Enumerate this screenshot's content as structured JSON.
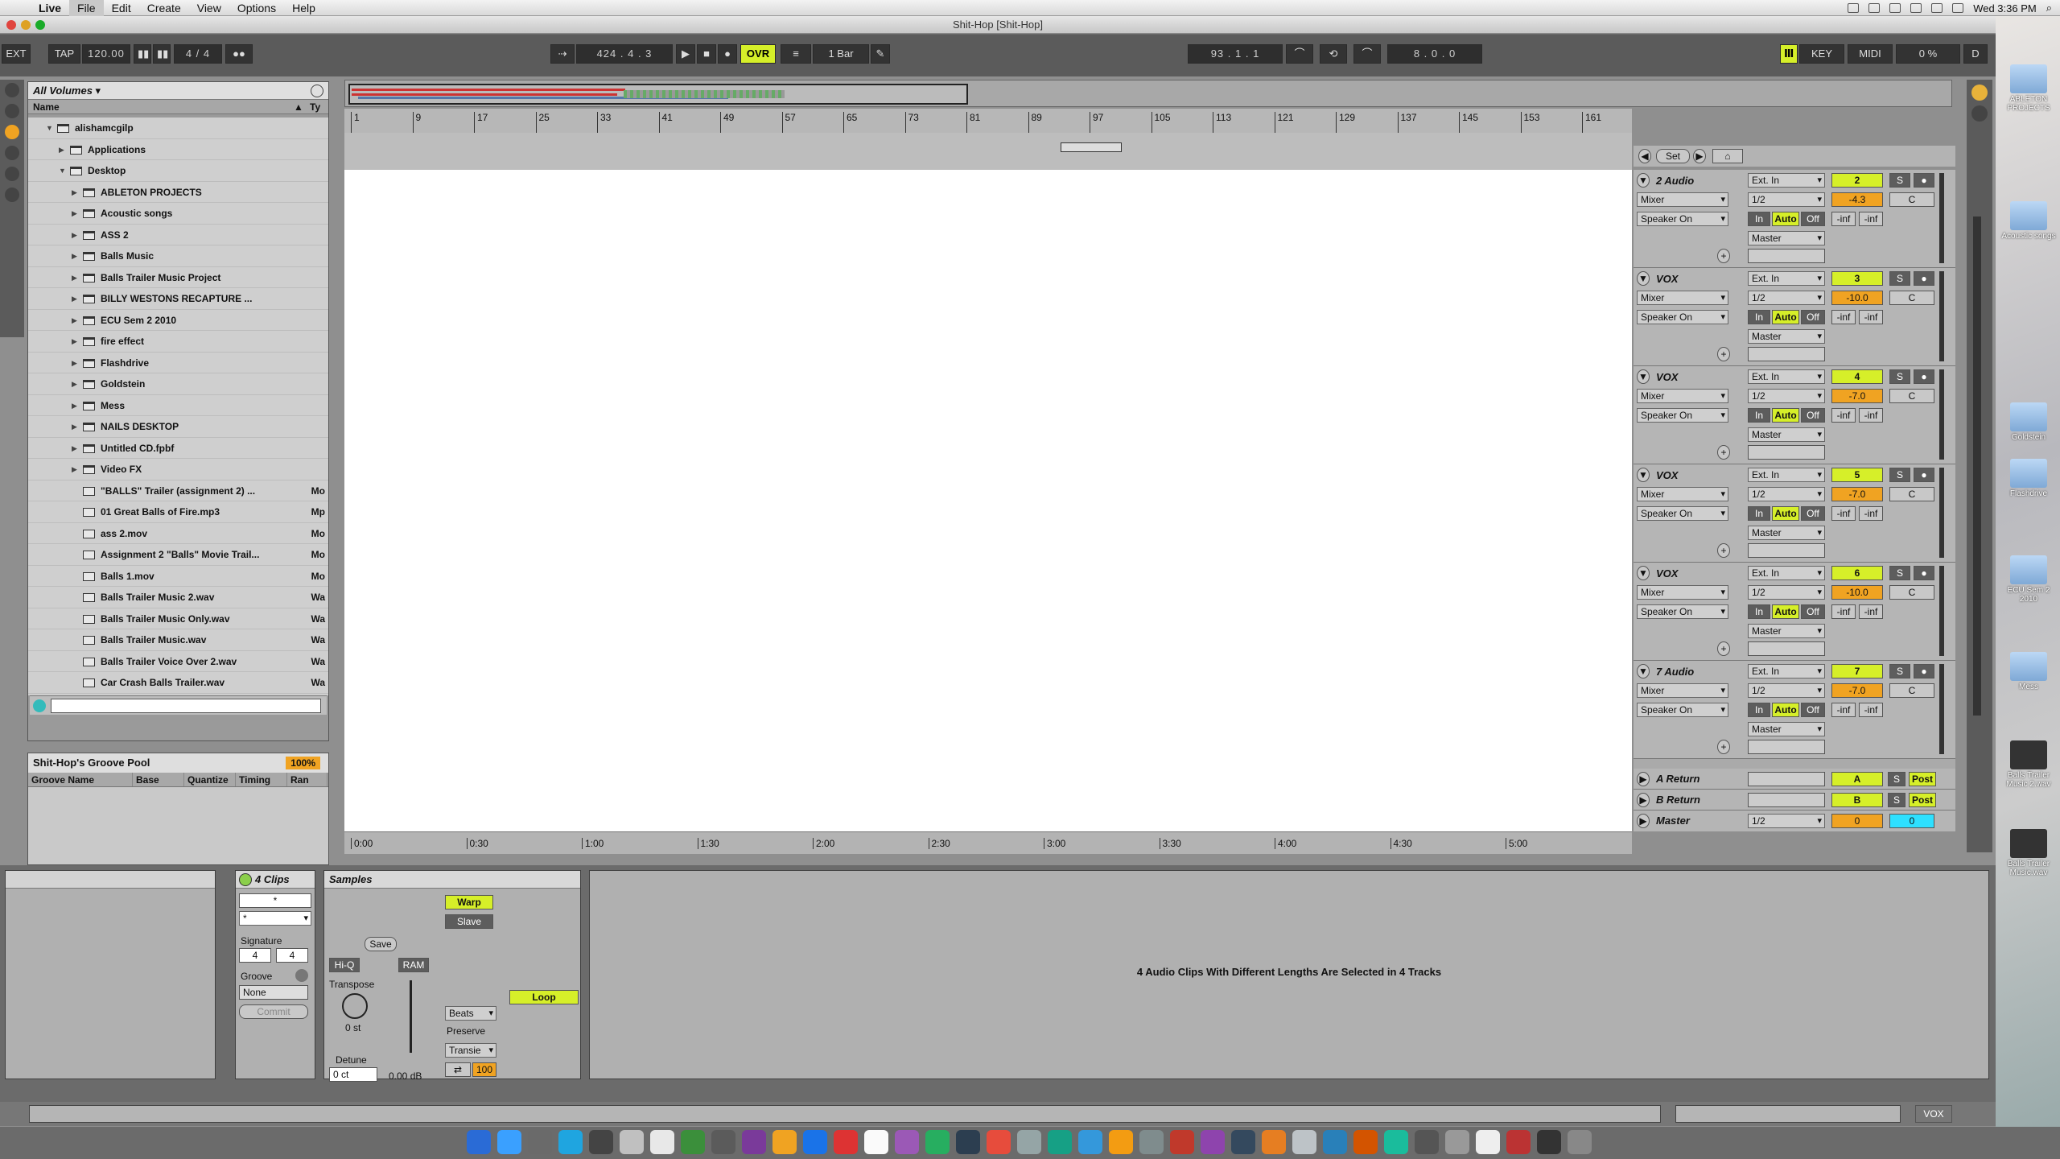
{
  "menubar": {
    "app": "Live",
    "items": [
      "File",
      "Edit",
      "Create",
      "View",
      "Options",
      "Help"
    ],
    "clock": "Wed 3:36 PM"
  },
  "window_title": "Shit-Hop  [Shit-Hop]",
  "control_bar": {
    "ext": "EXT",
    "tap": "TAP",
    "tempo": "120.00",
    "signature": "4 / 4",
    "position": "424 .  4 .  3",
    "ovr": "OVR",
    "quantize": "1 Bar",
    "loop_start": "93 .  1 .  1",
    "loop_length": "8 .  0 .  0",
    "key": "KEY",
    "midi": "MIDI",
    "cpu": "0 %",
    "d": "D"
  },
  "browser": {
    "location": "All Volumes",
    "col_name": "Name",
    "col_type": "Ty",
    "rows": [
      {
        "label": "alishamcgilp",
        "level": 1,
        "kind": "folder",
        "open": true,
        "type": ""
      },
      {
        "label": "Applications",
        "level": 2,
        "kind": "folder",
        "open": false,
        "type": ""
      },
      {
        "label": "Desktop",
        "level": 2,
        "kind": "folder",
        "open": true,
        "type": ""
      },
      {
        "label": "ABLETON PROJECTS",
        "level": 3,
        "kind": "folder",
        "open": false,
        "type": ""
      },
      {
        "label": "Acoustic songs",
        "level": 3,
        "kind": "folder",
        "open": false,
        "type": ""
      },
      {
        "label": "ASS 2",
        "level": 3,
        "kind": "folder",
        "open": false,
        "type": ""
      },
      {
        "label": "Balls Music",
        "level": 3,
        "kind": "folder",
        "open": false,
        "type": ""
      },
      {
        "label": "Balls Trailer Music Project",
        "level": 3,
        "kind": "folder",
        "open": false,
        "type": ""
      },
      {
        "label": "BILLY WESTONS RECAPTURE ...",
        "level": 3,
        "kind": "folder",
        "open": false,
        "type": ""
      },
      {
        "label": "ECU Sem 2 2010",
        "level": 3,
        "kind": "folder",
        "open": false,
        "type": ""
      },
      {
        "label": "fire effect",
        "level": 3,
        "kind": "folder",
        "open": false,
        "type": ""
      },
      {
        "label": "Flashdrive",
        "level": 3,
        "kind": "folder",
        "open": false,
        "type": ""
      },
      {
        "label": "Goldstein",
        "level": 3,
        "kind": "folder",
        "open": false,
        "type": ""
      },
      {
        "label": "Mess",
        "level": 3,
        "kind": "folder",
        "open": false,
        "type": ""
      },
      {
        "label": "NAILS DESKTOP",
        "level": 3,
        "kind": "folder",
        "open": false,
        "type": ""
      },
      {
        "label": "Untitled CD.fpbf",
        "level": 3,
        "kind": "folder",
        "open": false,
        "type": ""
      },
      {
        "label": "Video FX",
        "level": 3,
        "kind": "folder",
        "open": false,
        "type": ""
      },
      {
        "label": "\"BALLS\" Trailer (assignment 2) ...",
        "level": 3,
        "kind": "file",
        "type": "Mo"
      },
      {
        "label": "01 Great Balls of Fire.mp3",
        "level": 3,
        "kind": "file",
        "type": "Mp"
      },
      {
        "label": "ass 2.mov",
        "level": 3,
        "kind": "file",
        "type": "Mo"
      },
      {
        "label": "Assignment 2 \"Balls\" Movie Trail...",
        "level": 3,
        "kind": "file",
        "type": "Mo"
      },
      {
        "label": "Balls 1.mov",
        "level": 3,
        "kind": "file",
        "type": "Mo"
      },
      {
        "label": "Balls Trailer Music 2.wav",
        "level": 3,
        "kind": "file",
        "type": "Wa"
      },
      {
        "label": "Balls Trailer Music Only.wav",
        "level": 3,
        "kind": "file",
        "type": "Wa"
      },
      {
        "label": "Balls Trailer Music.wav",
        "level": 3,
        "kind": "file",
        "type": "Wa"
      },
      {
        "label": "Balls Trailer Voice Over 2.wav",
        "level": 3,
        "kind": "file",
        "type": "Wa"
      },
      {
        "label": "Car Crash Balls Trailer.wav",
        "level": 3,
        "kind": "file",
        "type": "Wa"
      }
    ]
  },
  "groove_pool": {
    "title": "Shit-Hop's Groove Pool",
    "amount": "100%",
    "columns": [
      "Groove Name",
      "Base",
      "Quantize",
      "Timing",
      "Ran"
    ]
  },
  "ruler_bars": [
    "1",
    "9",
    "17",
    "25",
    "33",
    "41",
    "49",
    "57",
    "65",
    "73",
    "81",
    "89",
    "97",
    "105",
    "113",
    "121",
    "129",
    "137",
    "145",
    "153",
    "161"
  ],
  "time_ruler": [
    "0:00",
    "0:30",
    "1:00",
    "1:30",
    "2:00",
    "2:30",
    "3:00",
    "3:30",
    "4:00",
    "4:30",
    "5:00"
  ],
  "set_button": "Set",
  "tracks": [
    {
      "name": "2 Audio",
      "input": "Ext. In",
      "chan": "1/2",
      "num": "2",
      "vol": "-4.3",
      "pan": "C",
      "routing": "Mixer",
      "speaker": "Speaker On",
      "out": "Master"
    },
    {
      "name": "VOX",
      "input": "Ext. In",
      "chan": "1/2",
      "num": "3",
      "vol": "-10.0",
      "pan": "C",
      "routing": "Mixer",
      "speaker": "Speaker On",
      "out": "Master"
    },
    {
      "name": "VOX",
      "input": "Ext. In",
      "chan": "1/2",
      "num": "4",
      "vol": "-7.0",
      "pan": "C",
      "routing": "Mixer",
      "speaker": "Speaker On",
      "out": "Master"
    },
    {
      "name": "VOX",
      "input": "Ext. In",
      "chan": "1/2",
      "num": "5",
      "vol": "-7.0",
      "pan": "C",
      "routing": "Mixer",
      "speaker": "Speaker On",
      "out": "Master"
    },
    {
      "name": "VOX",
      "input": "Ext. In",
      "chan": "1/2",
      "num": "6",
      "vol": "-10.0",
      "pan": "C",
      "routing": "Mixer",
      "speaker": "Speaker On",
      "out": "Master"
    },
    {
      "name": "7 Audio",
      "input": "Ext. In",
      "chan": "1/2",
      "num": "7",
      "vol": "-7.0",
      "pan": "C",
      "routing": "Mixer",
      "speaker": "Speaker On",
      "out": "Master"
    }
  ],
  "track_labels": {
    "in": "In",
    "auto": "Auto",
    "off": "Off",
    "inf": "-inf",
    "s": "S"
  },
  "returns": [
    {
      "name": "A Return",
      "letter": "A",
      "post": "Post",
      "s": "S"
    },
    {
      "name": "B Return",
      "letter": "B",
      "post": "Post",
      "s": "S"
    }
  ],
  "master": {
    "name": "Master",
    "chan": "1/2",
    "vol": "0",
    "cue": "0"
  },
  "clip_panel": {
    "title": "4 Clips",
    "signature_label": "Signature",
    "sig_num": "4",
    "sig_den": "4",
    "groove_label": "Groove",
    "groove_value": "None",
    "commit": "Commit"
  },
  "samples_panel": {
    "title": "Samples",
    "warp": "Warp",
    "slave": "Slave",
    "save": "Save",
    "hiq": "Hi-Q",
    "ram": "RAM",
    "transpose_label": "Transpose",
    "transpose_value": "0 st",
    "detune_label": "Detune",
    "detune_value": "0 ct",
    "gain": "0.00 dB",
    "mode": "Beats",
    "preserve_label": "Preserve",
    "preserve_value": "Transie",
    "rate": "100",
    "loop": "Loop"
  },
  "sample_message": "4 Audio Clips With Different Lengths Are Selected in 4 Tracks",
  "status_right": "VOX",
  "desktop_icons": [
    "ABLETON PROJECTS",
    "Acoustic songs",
    "Goldstein",
    "Flashdrive",
    "ECU Sem 2 2010",
    "Mess",
    "Balls Trailer Music 2.wav",
    "Balls Trailer Music.wav"
  ]
}
